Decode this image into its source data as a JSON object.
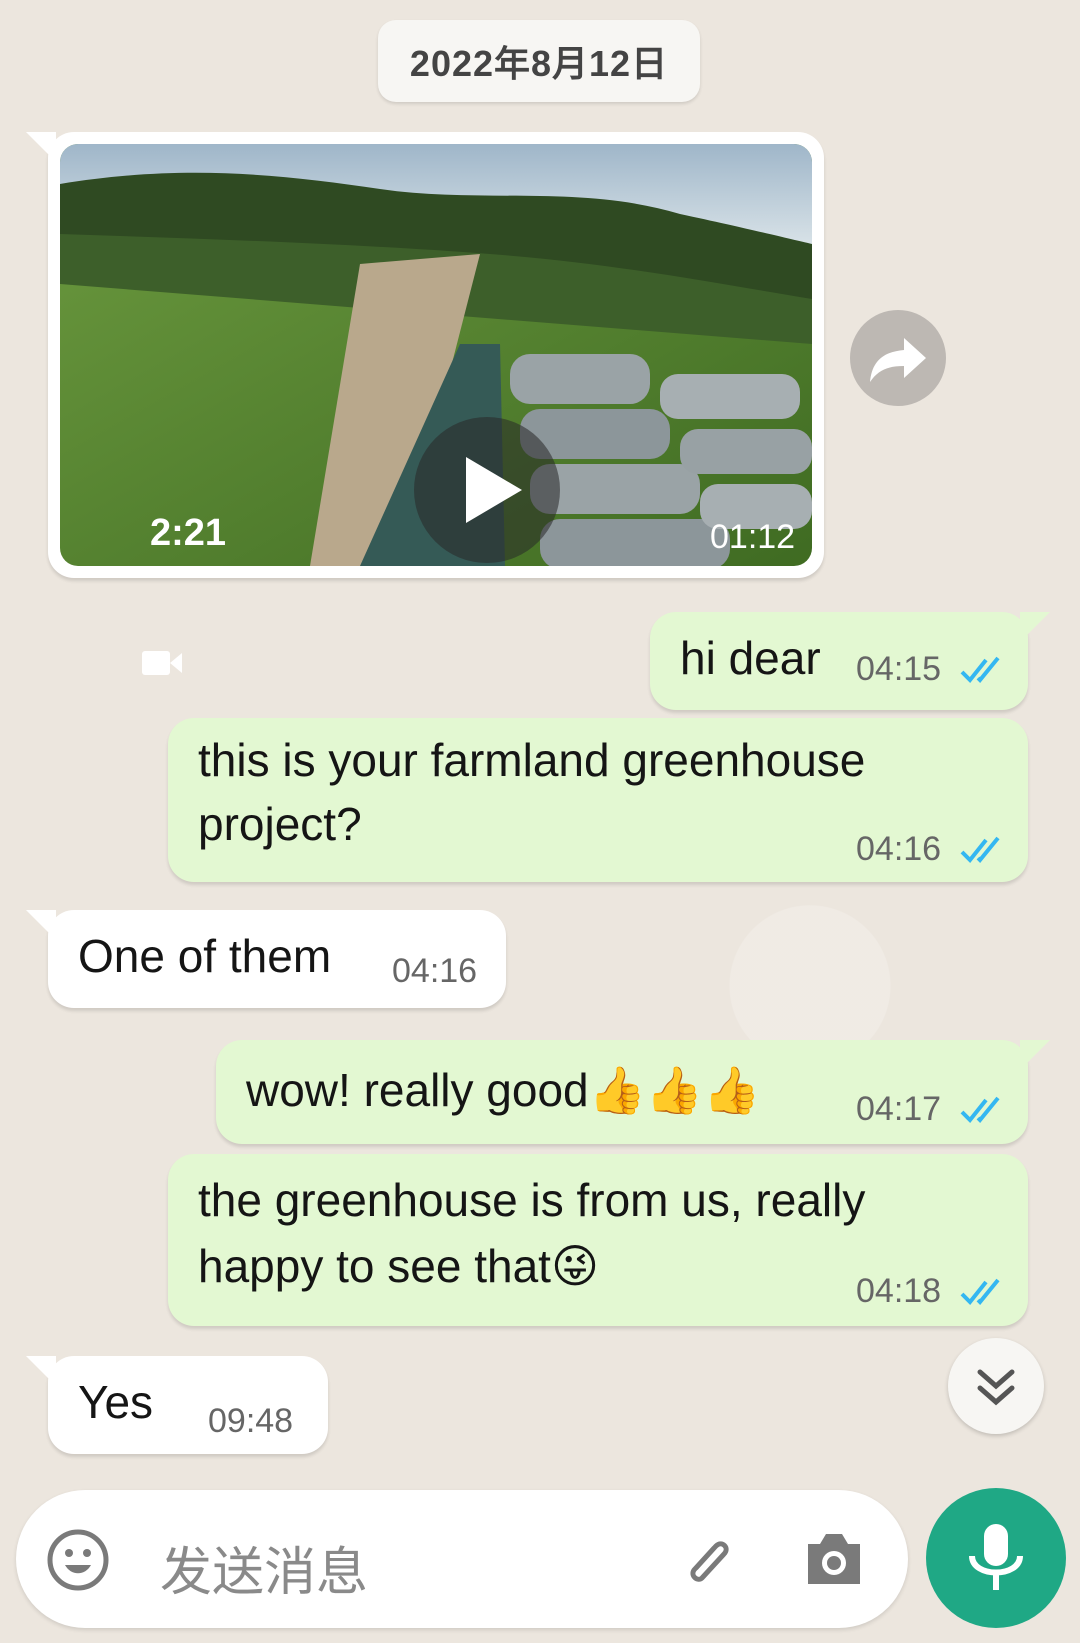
{
  "date_chip": "2022年8月12日",
  "video_message": {
    "duration": "2:21",
    "time": "01:12"
  },
  "messages": [
    {
      "direction": "out",
      "text": "hi dear",
      "time": "04:15"
    },
    {
      "direction": "out",
      "text_line1": "this is your farmland greenhouse",
      "text_line2": "project?",
      "time": "04:16"
    },
    {
      "direction": "in",
      "text": "One of them",
      "time": "04:16"
    },
    {
      "direction": "out",
      "text": "wow! really good",
      "emoji": "👍👍👍",
      "time": "04:17"
    },
    {
      "direction": "out",
      "text_line1": "the greenhouse is from us, really",
      "text_line2": "happy to see that",
      "emoji": "😜",
      "time": "04:18"
    },
    {
      "direction": "in",
      "text": "Yes",
      "time": "09:48"
    }
  ],
  "input": {
    "placeholder": "发送消息"
  },
  "colors": {
    "out_bubble": "#e3f8d2",
    "in_bubble": "#ffffff",
    "tick_blue": "#34b7f1",
    "mic_green": "#1fa885"
  },
  "icons": [
    "video-camera-icon",
    "play-icon",
    "share-icon",
    "double-check-icon",
    "scroll-down-icon",
    "emoji-icon",
    "attach-icon",
    "camera-icon",
    "mic-icon"
  ]
}
